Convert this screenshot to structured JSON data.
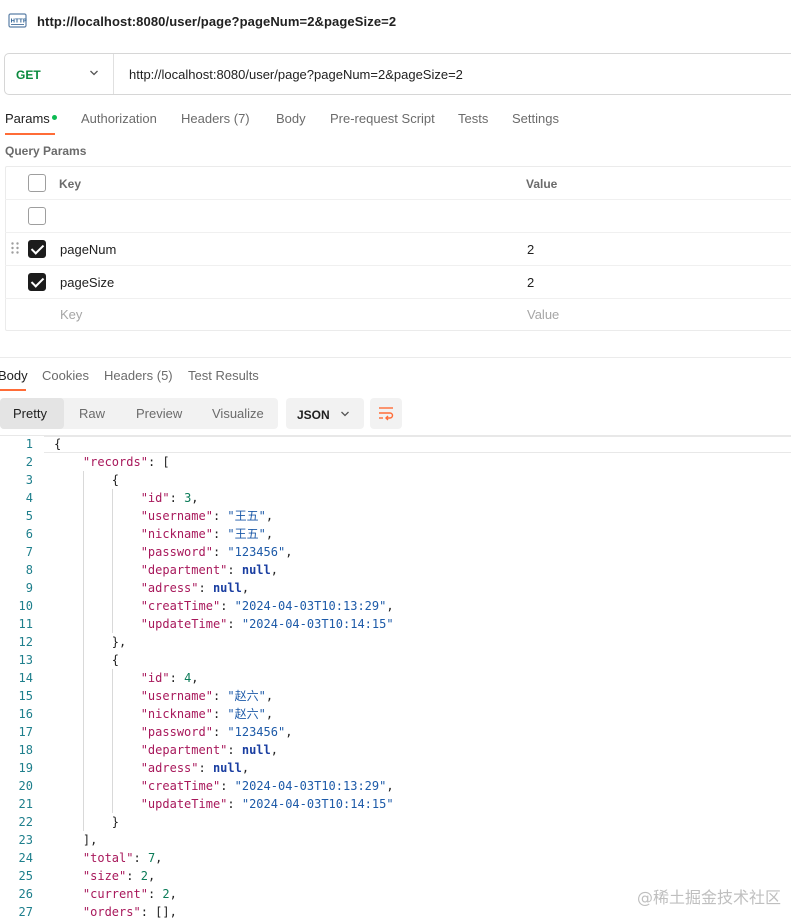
{
  "window": {
    "title": "http://localhost:8080/user/page?pageNum=2&pageSize=2",
    "icon": "http-request-icon"
  },
  "request": {
    "method": "GET",
    "url": "http://localhost:8080/user/page?pageNum=2&pageSize=2"
  },
  "request_tabs": [
    {
      "label": "Params"
    },
    {
      "label": "Authorization"
    },
    {
      "label": "Headers (7)"
    },
    {
      "label": "Body"
    },
    {
      "label": "Pre-request Script"
    },
    {
      "label": "Tests"
    },
    {
      "label": "Settings"
    }
  ],
  "query_params": {
    "section_label": "Query Params",
    "header": {
      "key": "Key",
      "value": "Value"
    },
    "rows": [
      {
        "key": "",
        "value": "",
        "checked": false
      },
      {
        "key": "pageNum",
        "value": "2",
        "checked": true
      },
      {
        "key": "pageSize",
        "value": "2",
        "checked": true
      }
    ],
    "placeholder": {
      "key": "Key",
      "value": "Value"
    }
  },
  "response_tabs": [
    {
      "label": "Body"
    },
    {
      "label": "Cookies"
    },
    {
      "label": "Headers (5)"
    },
    {
      "label": "Test Results"
    }
  ],
  "response_toolbar": {
    "formats": [
      "Pretty",
      "Raw",
      "Preview",
      "Visualize"
    ],
    "language": "JSON"
  },
  "response_body": {
    "line_numbers": [
      "1",
      "2",
      "3",
      "4",
      "5",
      "6",
      "7",
      "8",
      "9",
      "10",
      "11",
      "12",
      "13",
      "14",
      "15",
      "16",
      "17",
      "18",
      "19",
      "20",
      "21",
      "22",
      "23",
      "24",
      "25",
      "26",
      "27"
    ]
  },
  "watermark": "@稀土掘金技术社区",
  "colors": {
    "accent": "#ff6c37",
    "method_get": "#0a8a3e",
    "active_dot": "#0cbb52"
  }
}
